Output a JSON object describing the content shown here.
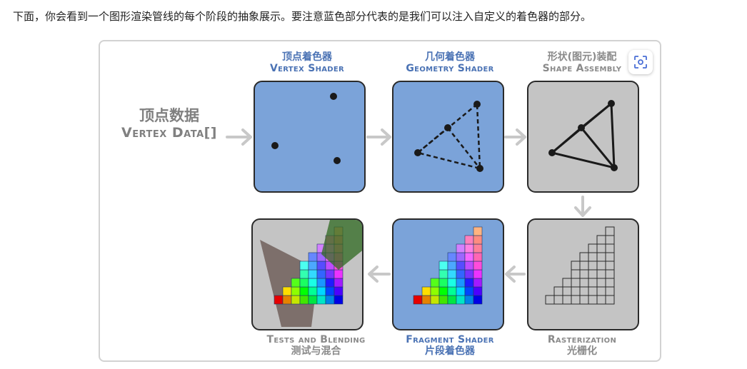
{
  "intro_text": "下面，你会看到一个图形渲染管线的每个阶段的抽象展示。要注意蓝色部分代表的是我们可以注入自定义的着色器的部分。",
  "vertex_data": {
    "zh": "顶点数据",
    "en": "Vertex Data[]"
  },
  "stages": [
    {
      "zh": "顶点着色器",
      "en": "Vertex Shader",
      "custom": true
    },
    {
      "zh": "几何着色器",
      "en": "Geometry Shader",
      "custom": true
    },
    {
      "zh": "形状(图元)装配",
      "en": "Shape Assembly",
      "custom": false
    },
    {
      "zh": "光栅化",
      "en": "Rasterization",
      "custom": false
    },
    {
      "zh": "片段着色器",
      "en": "Fragment Shader",
      "custom": true
    },
    {
      "zh": "测试与混合",
      "en": "Tests and Blending",
      "custom": false
    }
  ],
  "colors": {
    "custom_stage": "#7ba3d9",
    "fixed_stage": "#c4c4c4",
    "custom_label": "#4a72b4",
    "fixed_label": "#8a8a8a",
    "arrow": "#c8c8c8"
  },
  "icons": {
    "scan": "scan-icon"
  }
}
